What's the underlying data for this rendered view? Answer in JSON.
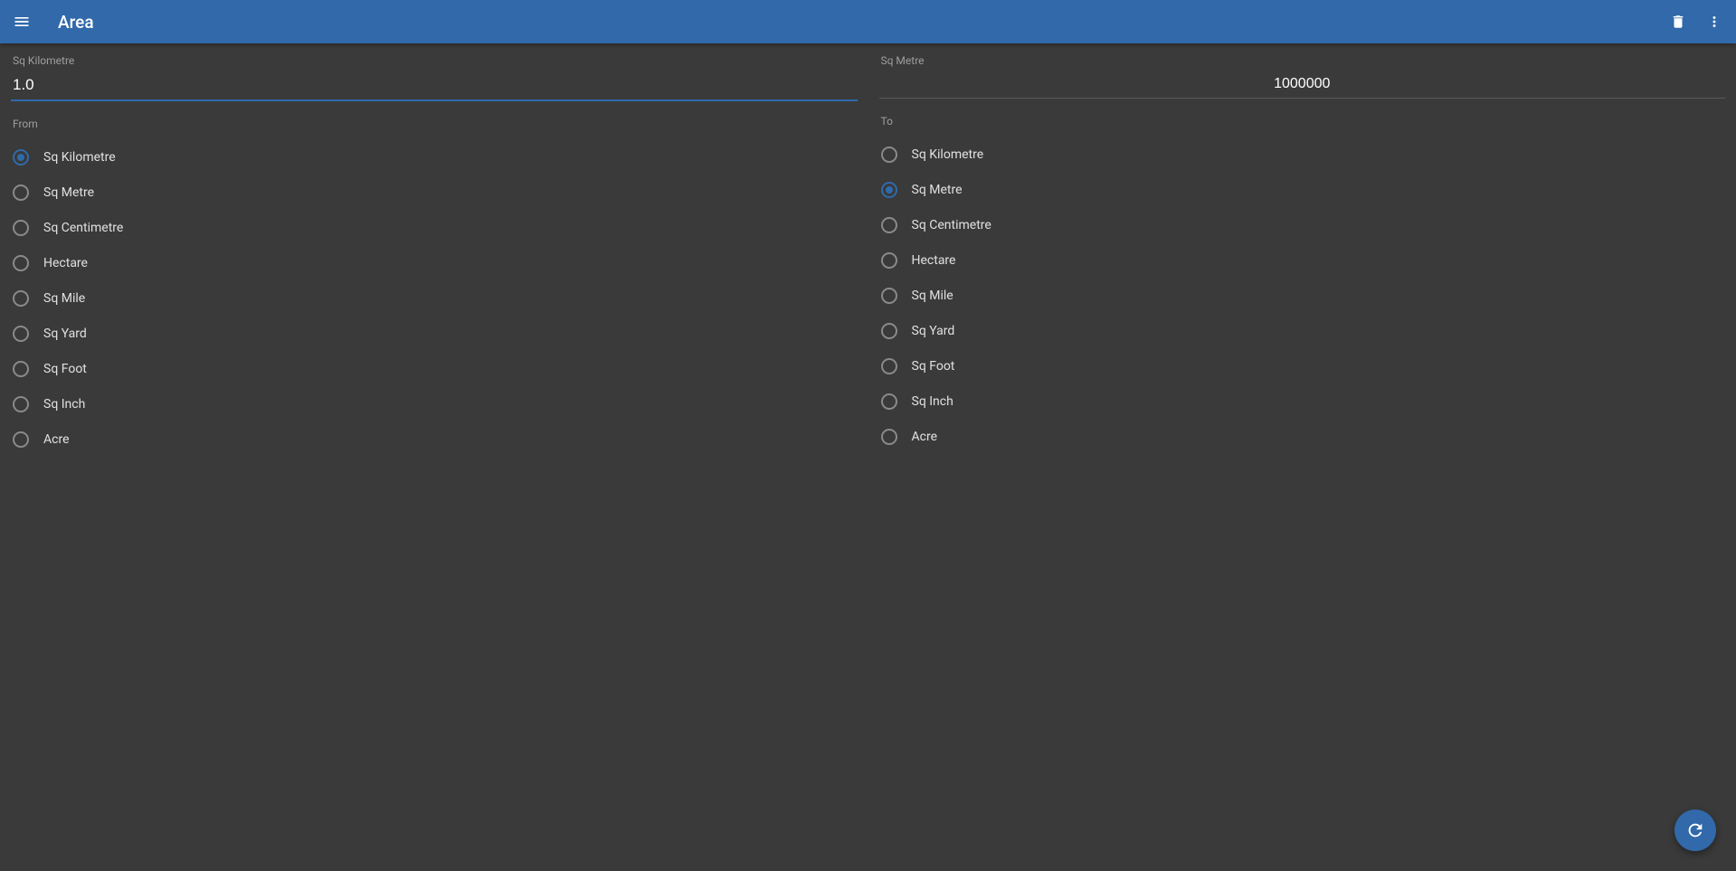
{
  "header": {
    "title": "Area"
  },
  "from": {
    "unit_label": "Sq Kilometre",
    "value": "1.0",
    "section_label": "From",
    "selected": "Sq Kilometre",
    "options": [
      {
        "label": "Sq Kilometre"
      },
      {
        "label": "Sq Metre"
      },
      {
        "label": "Sq Centimetre"
      },
      {
        "label": "Hectare"
      },
      {
        "label": "Sq Mile"
      },
      {
        "label": "Sq Yard"
      },
      {
        "label": "Sq Foot"
      },
      {
        "label": "Sq Inch"
      },
      {
        "label": "Acre"
      }
    ]
  },
  "to": {
    "unit_label": "Sq Metre",
    "value": "1000000",
    "section_label": "To",
    "selected": "Sq Metre",
    "options": [
      {
        "label": "Sq Kilometre"
      },
      {
        "label": "Sq Metre"
      },
      {
        "label": "Sq Centimetre"
      },
      {
        "label": "Hectare"
      },
      {
        "label": "Sq Mile"
      },
      {
        "label": "Sq Yard"
      },
      {
        "label": "Sq Foot"
      },
      {
        "label": "Sq Inch"
      },
      {
        "label": "Acre"
      }
    ]
  },
  "colors": {
    "primary": "#3169aa",
    "background": "#3a3a3a"
  }
}
